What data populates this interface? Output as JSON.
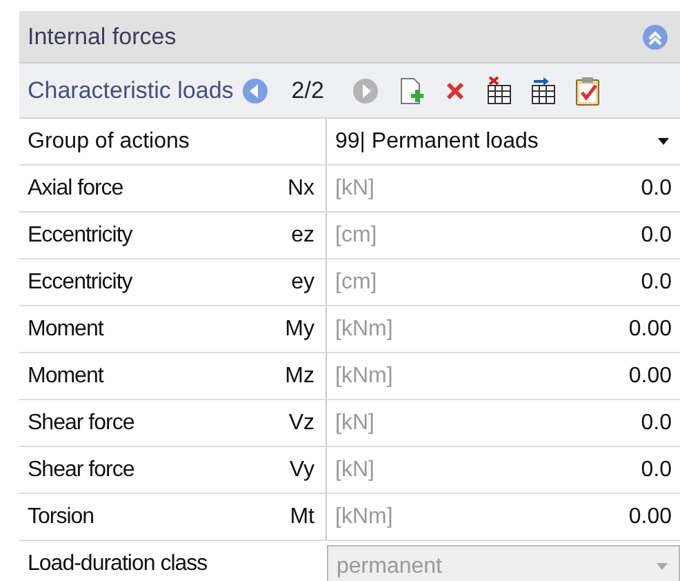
{
  "panel": {
    "title": "Internal forces",
    "expanded": true
  },
  "toolbar": {
    "label": "Characteristic loads",
    "counter": "2/2",
    "prev_disabled": false,
    "next_disabled": true
  },
  "group_of_actions": {
    "label": "Group of actions",
    "value": "99| Permanent loads"
  },
  "rows": [
    {
      "label": "Axial force",
      "symbol": "Nx",
      "unit": "[kN]",
      "value": "0.0"
    },
    {
      "label": "Eccentricity",
      "symbol": "ez",
      "unit": "[cm]",
      "value": "0.0"
    },
    {
      "label": "Eccentricity",
      "symbol": "ey",
      "unit": "[cm]",
      "value": "0.0"
    },
    {
      "label": "Moment",
      "symbol": "My",
      "unit": "[kNm]",
      "value": "0.00"
    },
    {
      "label": "Moment",
      "symbol": "Mz",
      "unit": "[kNm]",
      "value": "0.00"
    },
    {
      "label": "Shear force",
      "symbol": "Vz",
      "unit": "[kN]",
      "value": "0.0"
    },
    {
      "label": "Shear force",
      "symbol": "Vy",
      "unit": "[kN]",
      "value": "0.0"
    },
    {
      "label": "Torsion",
      "symbol": "Mt",
      "unit": "[kNm]",
      "value": "0.00"
    }
  ],
  "load_duration": {
    "label": "Load-duration class",
    "value": "permanent",
    "disabled": true
  }
}
